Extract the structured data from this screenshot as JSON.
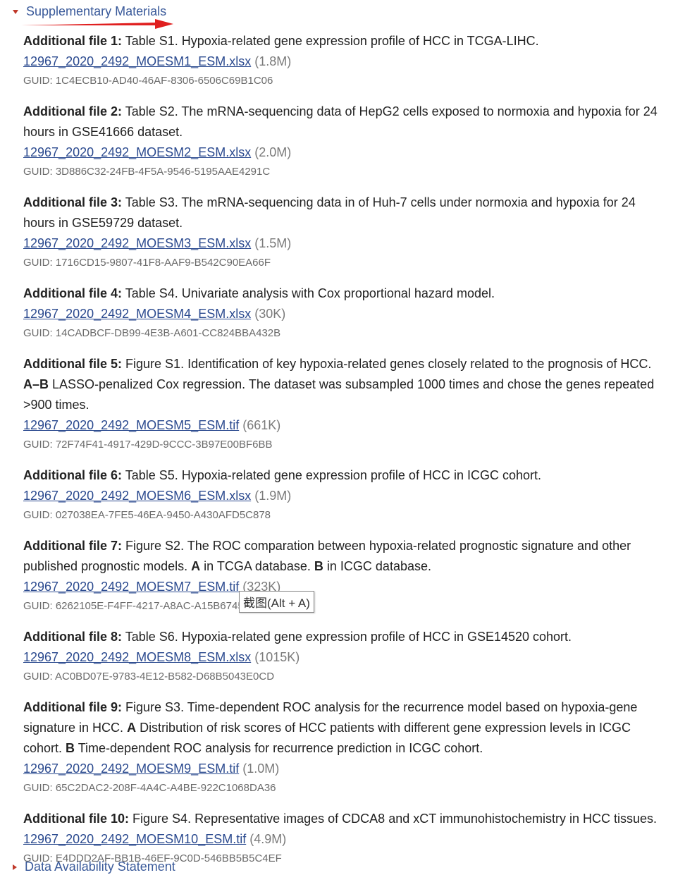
{
  "supplementary": {
    "title": "Supplementary Materials",
    "files": [
      {
        "label": "Additional file 1:",
        "segments": [
          "Table S1. Hypoxia-related gene expression profile of HCC in TCGA-LIHC."
        ],
        "filename": "12967_2020_2492_MOESM1_ESM.xlsx",
        "size": "(1.8M)",
        "guid": "GUID: 1C4ECB10-AD40-46AF-8306-6506C69B1C06"
      },
      {
        "label": "Additional file 2:",
        "segments": [
          "Table S2. The mRNA-sequencing data of HepG2 cells exposed to normoxia and hypoxia for 24 hours in GSE41666 dataset."
        ],
        "filename": "12967_2020_2492_MOESM2_ESM.xlsx",
        "size": "(2.0M)",
        "guid": "GUID: 3D886C32-24FB-4F5A-9546-5195AAE4291C"
      },
      {
        "label": "Additional file 3:",
        "segments": [
          "Table S3. The mRNA-sequencing data in of Huh-7 cells under normoxia and hypoxia for 24 hours in GSE59729 dataset."
        ],
        "filename": "12967_2020_2492_MOESM3_ESM.xlsx",
        "size": "(1.5M)",
        "guid": "GUID: 1716CD15-9807-41F8-AAF9-B542C90EA66F"
      },
      {
        "label": "Additional file 4:",
        "segments": [
          "Table S4. Univariate analysis with Cox proportional hazard model."
        ],
        "filename": "12967_2020_2492_MOESM4_ESM.xlsx",
        "size": "(30K)",
        "guid": "GUID: 14CADBCF-DB99-4E3B-A601-CC824BBA432B"
      },
      {
        "label": "Additional file 5:",
        "segments": [
          "Figure S1. Identification of key hypoxia-related genes closely related to the prognosis of HCC. ",
          "A–B",
          " LASSO-penalized Cox regression. The dataset was subsampled 1000 times and chose the genes repeated >900 times."
        ],
        "filename": "12967_2020_2492_MOESM5_ESM.tif",
        "size": "(661K)",
        "guid": "GUID: 72F74F41-4917-429D-9CCC-3B97E00BF6BB"
      },
      {
        "label": "Additional file 6:",
        "segments": [
          "Table S5. Hypoxia-related gene expression profile of HCC in ICGC cohort."
        ],
        "filename": "12967_2020_2492_MOESM6_ESM.xlsx",
        "size": "(1.9M)",
        "guid": "GUID: 027038EA-7FE5-46EA-9450-A430AFD5C878"
      },
      {
        "label": "Additional file 7:",
        "segments": [
          "Figure S2. The ROC comparation between hypoxia-related prognostic signature and other published prognostic models. ",
          "A",
          " in TCGA database. ",
          "B",
          " in ICGC database."
        ],
        "filename": "12967_2020_2492_MOESM7_ESM.tif",
        "size": "(323K)",
        "guid": "GUID: 6262105E-F4FF-4217-A8AC-A15B67459982"
      },
      {
        "label": "Additional file 8:",
        "segments": [
          "Table S6. Hypoxia-related gene expression profile of HCC in GSE14520 cohort."
        ],
        "filename": "12967_2020_2492_MOESM8_ESM.xlsx",
        "size": "(1015K)",
        "guid": "GUID: AC0BD07E-9783-4E12-B582-D68B5043E0CD"
      },
      {
        "label": "Additional file 9:",
        "segments": [
          "Figure S3. Time-dependent ROC analysis for the recurrence model based on hypoxia-gene signature in HCC. ",
          "A",
          " Distribution of risk scores of HCC patients with different gene expression levels in ICGC cohort. ",
          "B",
          " Time-dependent ROC analysis for recurrence prediction in ICGC cohort."
        ],
        "filename": "12967_2020_2492_MOESM9_ESM.tif",
        "size": "(1.0M)",
        "guid": "GUID: 65C2DAC2-208F-4A4C-A4BE-922C1068DA36"
      },
      {
        "label": "Additional file 10:",
        "segments": [
          "Figure S4. Representative images of CDCA8 and xCT immunohistochemistry in HCC tissues."
        ],
        "filename": "12967_2020_2492_MOESM10_ESM.tif",
        "size": "(4.9M)",
        "guid": "GUID: E4DDD2AF-BB1B-46EF-9C0D-546BB5B5C4EF"
      }
    ]
  },
  "tooltip": {
    "text": "截图(Alt + A)"
  },
  "data_availability": {
    "title": "Data Availability Statement"
  },
  "colors": {
    "link": "#2b4a8f",
    "header": "#3a5a9a",
    "marker": "#c0392b",
    "annotation_arrow": "#e02020"
  }
}
